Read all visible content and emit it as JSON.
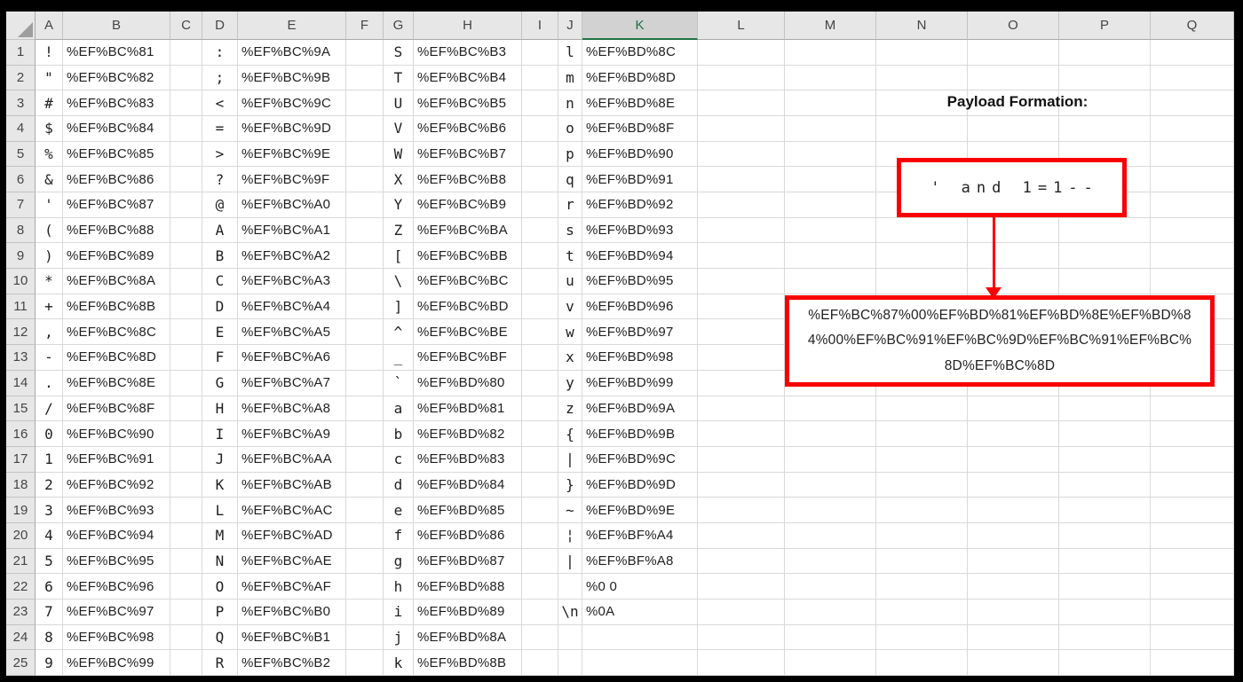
{
  "sheet": {
    "column_headers": [
      "A",
      "B",
      "C",
      "D",
      "E",
      "F",
      "G",
      "H",
      "I",
      "J",
      "K",
      "L",
      "M",
      "N",
      "O",
      "P",
      "Q"
    ],
    "selected_column": "K",
    "row_count": 25,
    "columns": {
      "A": [
        "!",
        "\"",
        "#",
        "$",
        "%",
        "&",
        "'",
        "(",
        ")",
        "*",
        "+",
        ",",
        "-",
        ".",
        "/",
        "0",
        "1",
        "2",
        "3",
        "4",
        "5",
        "6",
        "7",
        "8",
        "9"
      ],
      "B": [
        "%EF%BC%81",
        "%EF%BC%82",
        "%EF%BC%83",
        "%EF%BC%84",
        "%EF%BC%85",
        "%EF%BC%86",
        "%EF%BC%87",
        "%EF%BC%88",
        "%EF%BC%89",
        "%EF%BC%8A",
        "%EF%BC%8B",
        "%EF%BC%8C",
        "%EF%BC%8D",
        "%EF%BC%8E",
        "%EF%BC%8F",
        "%EF%BC%90",
        "%EF%BC%91",
        "%EF%BC%92",
        "%EF%BC%93",
        "%EF%BC%94",
        "%EF%BC%95",
        "%EF%BC%96",
        "%EF%BC%97",
        "%EF%BC%98",
        "%EF%BC%99"
      ],
      "D": [
        ":",
        ";",
        "<",
        "=",
        ">",
        "?",
        "@",
        "A",
        "B",
        "C",
        "D",
        "E",
        "F",
        "G",
        "H",
        "I",
        "J",
        "K",
        "L",
        "M",
        "N",
        "O",
        "P",
        "Q",
        "R"
      ],
      "E": [
        "%EF%BC%9A",
        "%EF%BC%9B",
        "%EF%BC%9C",
        "%EF%BC%9D",
        "%EF%BC%9E",
        "%EF%BC%9F",
        "%EF%BC%A0",
        "%EF%BC%A1",
        "%EF%BC%A2",
        "%EF%BC%A3",
        "%EF%BC%A4",
        "%EF%BC%A5",
        "%EF%BC%A6",
        "%EF%BC%A7",
        "%EF%BC%A8",
        "%EF%BC%A9",
        "%EF%BC%AA",
        "%EF%BC%AB",
        "%EF%BC%AC",
        "%EF%BC%AD",
        "%EF%BC%AE",
        "%EF%BC%AF",
        "%EF%BC%B0",
        "%EF%BC%B1",
        "%EF%BC%B2"
      ],
      "G": [
        "S",
        "T",
        "U",
        "V",
        "W",
        "X",
        "Y",
        "Z",
        "[",
        "\\",
        "]",
        "^",
        "_",
        "`",
        "a",
        "b",
        "c",
        "d",
        "e",
        "f",
        "g",
        "h",
        "i",
        "j",
        "k"
      ],
      "H": [
        "%EF%BC%B3",
        "%EF%BC%B4",
        "%EF%BC%B5",
        "%EF%BC%B6",
        "%EF%BC%B7",
        "%EF%BC%B8",
        "%EF%BC%B9",
        "%EF%BC%BA",
        "%EF%BC%BB",
        "%EF%BC%BC",
        "%EF%BC%BD",
        "%EF%BC%BE",
        "%EF%BC%BF",
        "%EF%BD%80",
        "%EF%BD%81",
        "%EF%BD%82",
        "%EF%BD%83",
        "%EF%BD%84",
        "%EF%BD%85",
        "%EF%BD%86",
        "%EF%BD%87",
        "%EF%BD%88",
        "%EF%BD%89",
        "%EF%BD%8A",
        "%EF%BD%8B"
      ],
      "J": [
        "l",
        "m",
        "n",
        "o",
        "p",
        "q",
        "r",
        "s",
        "t",
        "u",
        "v",
        "w",
        "x",
        "y",
        "z",
        "{",
        "|",
        "}",
        "~",
        "¦",
        "|",
        "",
        "\\n",
        "",
        ""
      ],
      "K": [
        "%EF%BD%8C",
        "%EF%BD%8D",
        "%EF%BD%8E",
        "%EF%BD%8F",
        "%EF%BD%90",
        "%EF%BD%91",
        "%EF%BD%92",
        "%EF%BD%93",
        "%EF%BD%94",
        "%EF%BD%95",
        "%EF%BD%96",
        "%EF%BD%97",
        "%EF%BD%98",
        "%EF%BD%99",
        "%EF%BD%9A",
        "%EF%BD%9B",
        "%EF%BD%9C",
        "%EF%BD%9D",
        "%EF%BD%9E",
        "%EF%BF%A4",
        "%EF%BF%A8",
        "%0 0",
        "%0A",
        "",
        ""
      ]
    }
  },
  "annotation": {
    "title": "Payload Formation:",
    "payload": "' and 1=1--",
    "encoded_payload": "%EF%BC%87%00%EF%BD%81%EF%BD%8E%EF%BD%84%00%EF%BC%91%EF%BC%9D%EF%BC%91%EF%BC%8D%EF%BC%8D",
    "accent_color": "#f80000"
  }
}
